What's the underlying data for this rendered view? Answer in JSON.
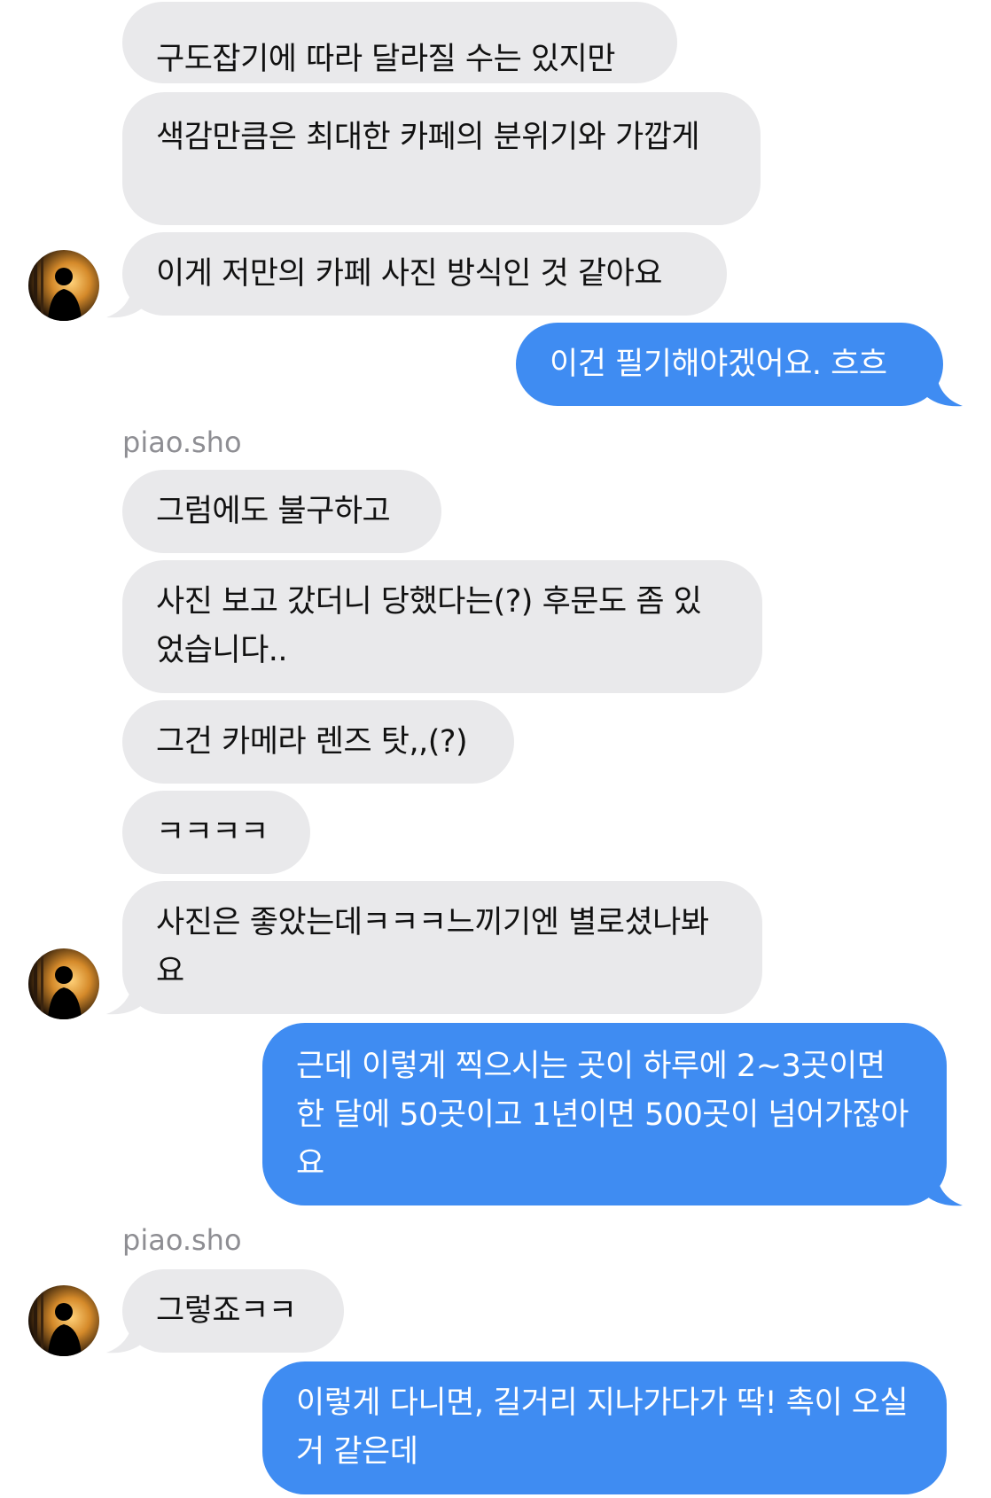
{
  "messages": [
    {
      "id": 1,
      "direction": "in",
      "text": "구도잡기에 따라 달라질 수는 있지만"
    },
    {
      "id": 2,
      "direction": "in",
      "text": "색감만큼은 최대한 카페의 분위기와 가깝게"
    },
    {
      "id": 3,
      "direction": "in",
      "text": "이게 저만의 카페 사진 방식인 것 같아요"
    },
    {
      "id": 4,
      "direction": "out",
      "text": "이건 필기해야겠어요. 흐흐"
    },
    {
      "id": 5,
      "direction": "in",
      "text": "그럼에도 불구하고"
    },
    {
      "id": 6,
      "direction": "in",
      "text": "사진 보고 갔더니 당했다는(?) 후문도 좀 있었습니다.."
    },
    {
      "id": 7,
      "direction": "in",
      "text": "그건 카메라 렌즈 탓,,(?)"
    },
    {
      "id": 8,
      "direction": "in",
      "text": "ㅋㅋㅋㅋ"
    },
    {
      "id": 9,
      "direction": "in",
      "text": "사진은 좋았는데ㅋㅋㅋ느끼기엔 별로셨나봐요"
    },
    {
      "id": 10,
      "direction": "out",
      "text": "근데 이렇게 찍으시는 곳이 하루에 2~3곳이면 한 달에 50곳이고 1년이면 500곳이 넘어가잖아요"
    },
    {
      "id": 11,
      "direction": "in",
      "text": "그렇죠ㅋㅋ"
    },
    {
      "id": 12,
      "direction": "out",
      "text": "이렇게 다니면, 길거리 지나가다가 딱! 촉이 오실 거 같은데"
    }
  ],
  "sender_labels": [
    "piao.sho",
    "piao.sho"
  ],
  "colors": {
    "incoming_bubble": "#e9e9eb",
    "outgoing_bubble": "#3f8cf2",
    "sender_label": "#8e8e93"
  }
}
